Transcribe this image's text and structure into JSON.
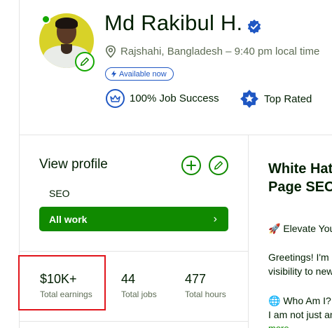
{
  "profile": {
    "name": "Md Rakibul H.",
    "location": "Rajshahi, Bangladesh – 9:40 pm local time",
    "availability": "Available now",
    "badges": {
      "job_success": "100% Job Success",
      "top_rated": "Top Rated"
    }
  },
  "sidebar": {
    "view_profile": "View profile",
    "tag": "SEO",
    "all_work": "All work",
    "all_work_chevron": "›"
  },
  "stats": [
    {
      "value": "$10K+",
      "label": "Total earnings"
    },
    {
      "value": "44",
      "label": "Total jobs"
    },
    {
      "value": "477",
      "label": "Total hours"
    }
  ],
  "main": {
    "title_line1": "White Hat",
    "title_line2": "Page SEO",
    "para1": "🚀 Elevate Your",
    "para2_line1": "Greetings! I'm",
    "para2_line2": "visibility to new",
    "para3_line1": "🌐 Who Am I?",
    "para3_line2": "I am not just an",
    "more_link": "more"
  },
  "colors": {
    "accent": "#108a00",
    "badge_blue": "#1f57c3",
    "highlight_red": "#e1141b"
  },
  "icons": {
    "online": "online-dot",
    "edit": "pencil-icon",
    "verified": "verified-check-icon",
    "location": "map-pin-icon",
    "bolt": "lightning-icon",
    "crown": "crown-icon",
    "top_rated": "top-rated-star-icon",
    "add": "plus-icon"
  }
}
